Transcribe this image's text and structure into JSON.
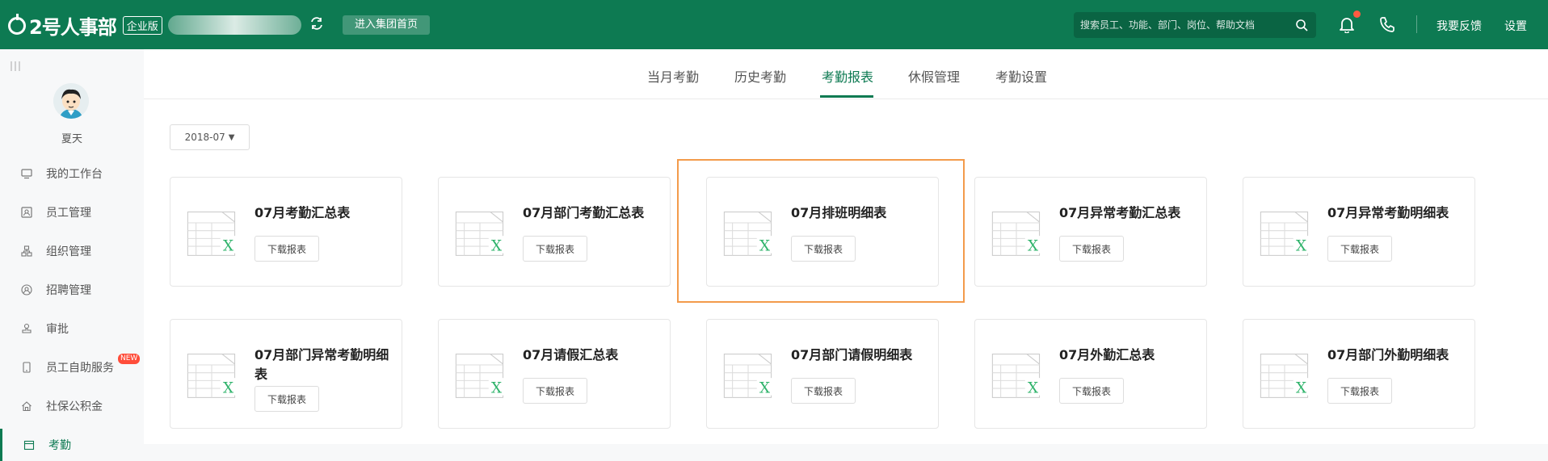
{
  "header": {
    "logo_text": "2号人事部",
    "edition": "企业版",
    "company_name": "",
    "enter_group": "进入集团首页",
    "search_placeholder": "搜索员工、功能、部门、岗位、帮助文档",
    "feedback": "我要反馈",
    "settings": "设置"
  },
  "sidebar": {
    "user_name": "夏天",
    "items": [
      {
        "label": "我的工作台",
        "icon": "monitor-icon"
      },
      {
        "label": "员工管理",
        "icon": "id-card-icon"
      },
      {
        "label": "组织管理",
        "icon": "org-chart-icon"
      },
      {
        "label": "招聘管理",
        "icon": "recruit-icon"
      },
      {
        "label": "审批",
        "icon": "stamp-icon"
      },
      {
        "label": "员工自助服务",
        "icon": "mobile-icon",
        "badge": "NEW"
      },
      {
        "label": "社保公积金",
        "icon": "home-icon"
      },
      {
        "label": "考勤",
        "icon": "calendar-icon"
      }
    ]
  },
  "tabs": [
    "当月考勤",
    "历史考勤",
    "考勤报表",
    "休假管理",
    "考勤设置"
  ],
  "active_tab": "考勤报表",
  "date_filter": "2018-07",
  "download_label": "下载报表",
  "reports": [
    "07月考勤汇总表",
    "07月部门考勤汇总表",
    "07月排班明细表",
    "07月异常考勤汇总表",
    "07月异常考勤明细表",
    "07月部门异常考勤明细表",
    "07月请假汇总表",
    "07月部门请假明细表",
    "07月外勤汇总表",
    "07月部门外勤明细表"
  ],
  "colors": {
    "brand": "#0d7a52",
    "highlight": "#f39b4b",
    "excel_green": "#2fb36b",
    "badge_red": "#ff4d3a"
  }
}
